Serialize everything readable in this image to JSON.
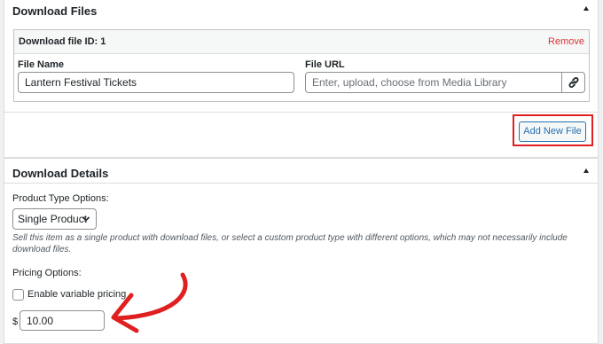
{
  "download_files": {
    "title": "Download Files",
    "file": {
      "id_label": "Download file ID: 1",
      "remove": "Remove",
      "file_name_label": "File Name",
      "file_name_value": "Lantern Festival Tickets",
      "file_url_label": "File URL",
      "file_url_placeholder": "Enter, upload, choose from Media Library"
    },
    "add_button": "Add New File"
  },
  "download_details": {
    "title": "Download Details",
    "product_type_label": "Product Type Options:",
    "product_type_selected": "Single Product",
    "product_type_desc": "Sell this item as a single product with download files, or select a custom product type with different options, which may not necessarily include download files.",
    "pricing_label": "Pricing Options:",
    "variable_pricing_label": "Enable variable pricing",
    "currency": "$",
    "price": "10.00"
  },
  "colors": {
    "accent": "#2271b1",
    "annotation": "#e02020",
    "remove": "#d63638"
  }
}
